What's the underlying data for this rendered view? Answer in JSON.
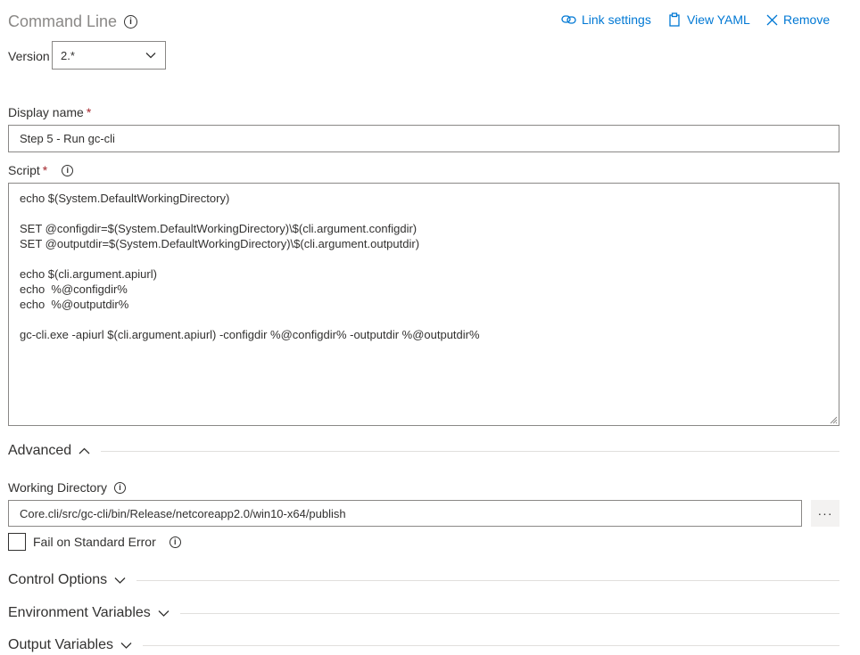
{
  "header": {
    "title": "Command Line",
    "link_settings": "Link settings",
    "view_yaml": "View YAML",
    "remove": "Remove"
  },
  "version": {
    "label": "Version",
    "value": "2.*"
  },
  "display_name": {
    "label": "Display name",
    "required": "*",
    "value": "Step 5 - Run gc-cli"
  },
  "script": {
    "label": "Script",
    "required": "*",
    "value": "echo $(System.DefaultWorkingDirectory)\n\nSET @configdir=$(System.DefaultWorkingDirectory)\\$(cli.argument.configdir)\nSET @outputdir=$(System.DefaultWorkingDirectory)\\$(cli.argument.outputdir)\n\necho $(cli.argument.apiurl)\necho  %@configdir%\necho  %@outputdir%\n\ngc-cli.exe -apiurl $(cli.argument.apiurl) -configdir %@configdir% -outputdir %@outputdir%"
  },
  "advanced": {
    "label": "Advanced",
    "expanded": true,
    "working_directory": {
      "label": "Working Directory",
      "value": "Core.cli/src/gc-cli/bin/Release/netcoreapp2.0/win10-x64/publish",
      "browse_label": "···"
    },
    "fail_on_stderr": {
      "label": "Fail on Standard Error",
      "checked": false
    }
  },
  "sections": {
    "control_options": "Control Options",
    "environment_variables": "Environment Variables",
    "output_variables": "Output Variables"
  },
  "icons": {
    "info": "i",
    "link": "link-icon",
    "clipboard": "clipboard-icon",
    "close": "close-icon",
    "chevron_down": "chevron-down-icon",
    "chevron_up": "chevron-up-icon"
  },
  "colors": {
    "accent": "#0078d4",
    "required": "#a4262c",
    "muted": "#8a8886",
    "text": "#323130"
  }
}
